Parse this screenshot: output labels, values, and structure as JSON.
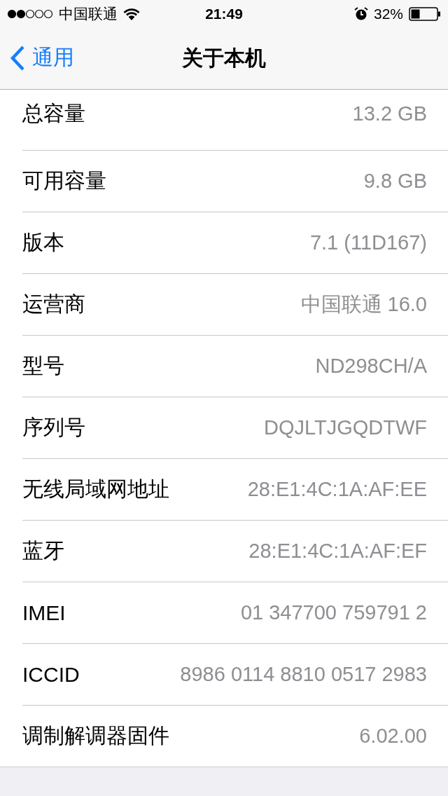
{
  "status_bar": {
    "carrier": "中国联通",
    "time": "21:49",
    "battery": "32%"
  },
  "nav": {
    "back": "通用",
    "title": "关于本机"
  },
  "rows": [
    {
      "label": "总容量",
      "value": "13.2 GB"
    },
    {
      "label": "可用容量",
      "value": "9.8 GB"
    },
    {
      "label": "版本",
      "value": "7.1 (11D167)"
    },
    {
      "label": "运营商",
      "value": "中国联通 16.0"
    },
    {
      "label": "型号",
      "value": "ND298CH/A"
    },
    {
      "label": "序列号",
      "value": "DQJLTJGQDTWF"
    },
    {
      "label": "无线局域网地址",
      "value": "28:E1:4C:1A:AF:EE"
    },
    {
      "label": "蓝牙",
      "value": "28:E1:4C:1A:AF:EF"
    },
    {
      "label": "IMEI",
      "value": "01 347700 759791 2"
    },
    {
      "label": "ICCID",
      "value": "8986 0114 8810 0517 2983"
    },
    {
      "label": "调制解调器固件",
      "value": "6.02.00"
    }
  ]
}
